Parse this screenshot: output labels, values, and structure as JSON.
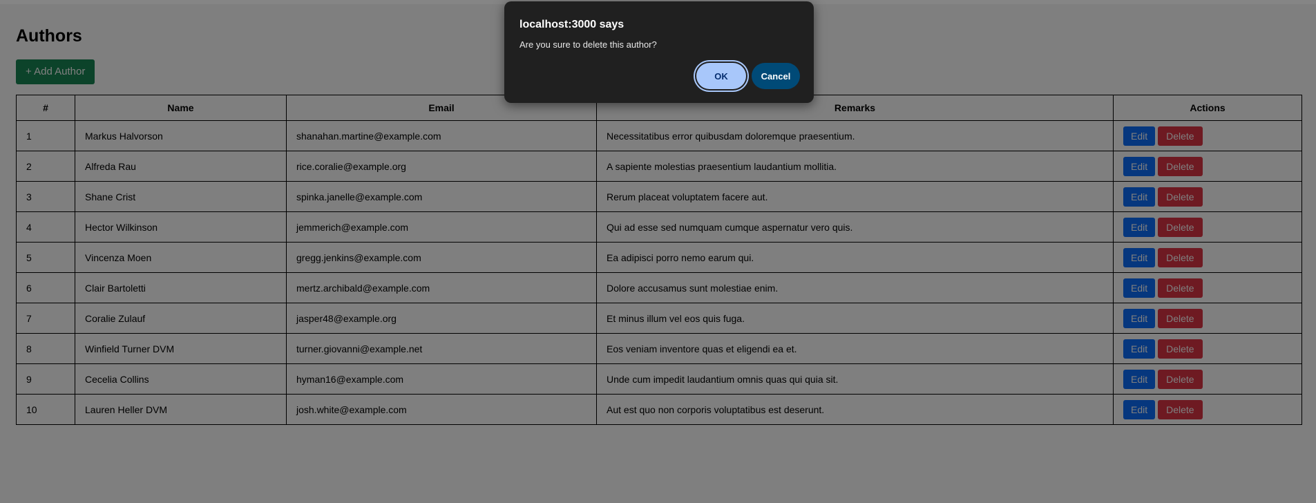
{
  "page": {
    "title": "Authors",
    "add_button_label": "+ Add Author"
  },
  "table": {
    "headers": [
      "#",
      "Name",
      "Email",
      "Remarks",
      "Actions"
    ],
    "rows": [
      {
        "id": "1",
        "name": "Markus Halvorson",
        "email": "shanahan.martine@example.com",
        "remarks": "Necessitatibus error quibusdam doloremque praesentium."
      },
      {
        "id": "2",
        "name": "Alfreda Rau",
        "email": "rice.coralie@example.org",
        "remarks": "A sapiente molestias praesentium laudantium mollitia."
      },
      {
        "id": "3",
        "name": "Shane Crist",
        "email": "spinka.janelle@example.com",
        "remarks": "Rerum placeat voluptatem facere aut."
      },
      {
        "id": "4",
        "name": "Hector Wilkinson",
        "email": "jemmerich@example.com",
        "remarks": "Qui ad esse sed numquam cumque aspernatur vero quis."
      },
      {
        "id": "5",
        "name": "Vincenza Moen",
        "email": "gregg.jenkins@example.com",
        "remarks": "Ea adipisci porro nemo earum qui."
      },
      {
        "id": "6",
        "name": "Clair Bartoletti",
        "email": "mertz.archibald@example.com",
        "remarks": "Dolore accusamus sunt molestiae enim."
      },
      {
        "id": "7",
        "name": "Coralie Zulauf",
        "email": "jasper48@example.org",
        "remarks": "Et minus illum vel eos quis fuga."
      },
      {
        "id": "8",
        "name": "Winfield Turner DVM",
        "email": "turner.giovanni@example.net",
        "remarks": "Eos veniam inventore quas et eligendi ea et."
      },
      {
        "id": "9",
        "name": "Cecelia Collins",
        "email": "hyman16@example.com",
        "remarks": "Unde cum impedit laudantium omnis quas qui quia sit."
      },
      {
        "id": "10",
        "name": "Lauren Heller DVM",
        "email": "josh.white@example.com",
        "remarks": "Aut est quo non corporis voluptatibus est deserunt."
      }
    ],
    "edit_label": "Edit",
    "delete_label": "Delete"
  },
  "dialog": {
    "title": "localhost:3000 says",
    "message": "Are you sure to delete this author?",
    "ok_label": "OK",
    "cancel_label": "Cancel"
  },
  "colors": {
    "add_button": "#198754",
    "edit_button": "#0d6efd",
    "delete_button": "#dc3545",
    "dialog_background": "#202020",
    "dialog_ok": "#a8c7fa",
    "dialog_cancel": "#004a77"
  }
}
